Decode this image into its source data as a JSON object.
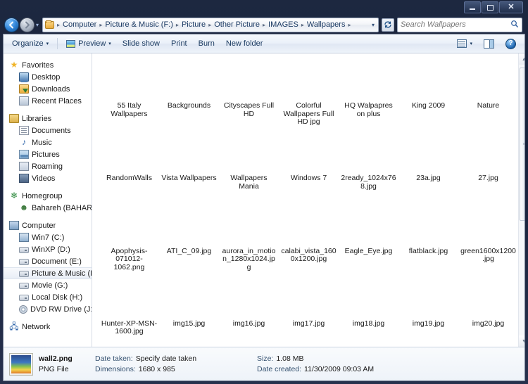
{
  "window": {
    "minimize_label": "Minimize",
    "maximize_label": "Maximize",
    "close_label": "✕"
  },
  "address": {
    "folder_icon": "folder-icon",
    "back_label": "Back",
    "forward_label": "Forward",
    "history_caret": "▾",
    "breadcrumb": [
      "Computer",
      "Picture & Music (F:)",
      "Picture",
      "Other Picture",
      "IMAGES",
      "Wallpapers"
    ],
    "separator": "▸",
    "dropdown_caret": "▾",
    "refresh_glyph": "↻"
  },
  "search": {
    "placeholder": "Search Wallpapers",
    "value": "",
    "icon": "search-icon"
  },
  "toolbar": {
    "organize": "Organize",
    "preview": "Preview",
    "slideshow": "Slide show",
    "print": "Print",
    "burn": "Burn",
    "newfolder": "New folder",
    "caret": "▾",
    "view_icon": "view-icon",
    "pane_icon": "preview-pane-icon",
    "help_icon": "help-icon",
    "help_glyph": "?"
  },
  "navpane": {
    "groups": [
      {
        "root": {
          "label": "Favorites",
          "icon": "star-icon",
          "ico_class": "ico-star",
          "glyph": "★"
        },
        "items": [
          {
            "label": "Desktop",
            "icon": "desktop-icon",
            "ico_class": "ico-desktop",
            "glyph": ""
          },
          {
            "label": "Downloads",
            "icon": "downloads-icon",
            "ico_class": "ico-dl",
            "glyph": ""
          },
          {
            "label": "Recent Places",
            "icon": "recent-places-icon",
            "ico_class": "ico-recent",
            "glyph": ""
          }
        ]
      },
      {
        "root": {
          "label": "Libraries",
          "icon": "libraries-icon",
          "ico_class": "ico-lib",
          "glyph": ""
        },
        "items": [
          {
            "label": "Documents",
            "icon": "documents-icon",
            "ico_class": "ico-doc",
            "glyph": ""
          },
          {
            "label": "Music",
            "icon": "music-icon",
            "ico_class": "ico-music",
            "glyph": "♪"
          },
          {
            "label": "Pictures",
            "icon": "pictures-icon",
            "ico_class": "ico-pic",
            "glyph": ""
          },
          {
            "label": "Roaming",
            "icon": "roaming-icon",
            "ico_class": "ico-roam",
            "glyph": ""
          },
          {
            "label": "Videos",
            "icon": "videos-icon",
            "ico_class": "ico-video",
            "glyph": ""
          }
        ]
      },
      {
        "root": {
          "label": "Homegroup",
          "icon": "homegroup-icon",
          "ico_class": "ico-home",
          "glyph": "❄"
        },
        "items": [
          {
            "label": "Bahareh (BAHAREH",
            "icon": "user-icon",
            "ico_class": "ico-user",
            "glyph": "☻"
          }
        ]
      },
      {
        "root": {
          "label": "Computer",
          "icon": "computer-icon",
          "ico_class": "ico-computer",
          "glyph": ""
        },
        "items": [
          {
            "label": "Win7 (C:)",
            "icon": "drive-windows-icon",
            "ico_class": "ico-win7",
            "glyph": ""
          },
          {
            "label": "WinXP (D:)",
            "icon": "drive-icon",
            "ico_class": "ico-drive",
            "glyph": ""
          },
          {
            "label": "Document (E:)",
            "icon": "drive-icon",
            "ico_class": "ico-drive",
            "glyph": ""
          },
          {
            "label": "Picture & Music (F:",
            "icon": "drive-icon",
            "ico_class": "ico-drive",
            "glyph": "",
            "selected": true
          },
          {
            "label": "Movie (G:)",
            "icon": "drive-icon",
            "ico_class": "ico-drive",
            "glyph": ""
          },
          {
            "label": "Local Disk (H:)",
            "icon": "drive-icon",
            "ico_class": "ico-drive",
            "glyph": ""
          },
          {
            "label": "DVD RW Drive (J:)",
            "icon": "dvd-drive-icon",
            "ico_class": "ico-dvd",
            "glyph": ""
          }
        ]
      },
      {
        "root": {
          "label": "Network",
          "icon": "network-icon",
          "ico_class": "ico-net",
          "glyph": "🖧"
        },
        "items": []
      }
    ]
  },
  "files": {
    "rows": [
      [
        {
          "name": "55 Italy Wallpapers"
        },
        {
          "name": "Backgrounds"
        },
        {
          "name": "Cityscapes Full HD"
        },
        {
          "name": "Colorful Wallpapers Full HD jpg"
        },
        {
          "name": "HQ  Walpapres on plus"
        },
        {
          "name": "King 2009"
        },
        {
          "name": "Nature"
        }
      ],
      [
        {
          "name": "RandomWalls"
        },
        {
          "name": "Vista Wallpapers"
        },
        {
          "name": "Wallpapers Mania"
        },
        {
          "name": "Windows 7"
        },
        {
          "name": "2ready_1024x768.jpg"
        },
        {
          "name": "23a.jpg"
        },
        {
          "name": "27.jpg"
        }
      ],
      [
        {
          "name": "Apophysis-071012-1062.png"
        },
        {
          "name": "ATI_C_09.jpg"
        },
        {
          "name": "aurora_in_motion_1280x1024.jpg"
        },
        {
          "name": "calabi_vista_1600x1200.jpg"
        },
        {
          "name": "Eagle_Eye.jpg"
        },
        {
          "name": "flatblack.jpg"
        },
        {
          "name": "green1600x1200.jpg"
        }
      ],
      [
        {
          "name": "Hunter-XP-MSN-1600.jpg"
        },
        {
          "name": "img15.jpg"
        },
        {
          "name": "img16.jpg"
        },
        {
          "name": "img17.jpg"
        },
        {
          "name": "img18.jpg"
        },
        {
          "name": "img19.jpg"
        },
        {
          "name": "img20.jpg"
        }
      ]
    ]
  },
  "scrollbar": {
    "up_glyph": "▲",
    "down_glyph": "▼",
    "thumb_grip": "≡"
  },
  "details": {
    "filename": "wall2.png",
    "filetype": "PNG File",
    "date_taken_key": "Date taken:",
    "date_taken_val": "Specify date taken",
    "dimensions_key": "Dimensions:",
    "dimensions_val": "1680 x 985",
    "size_key": "Size:",
    "size_val": "1.08 MB",
    "created_key": "Date created:",
    "created_val": "11/30/2009 09:03 AM"
  },
  "colors": {
    "titlebar": "#1d2840",
    "accent": "#17375e",
    "selection": "#e9eef6"
  }
}
